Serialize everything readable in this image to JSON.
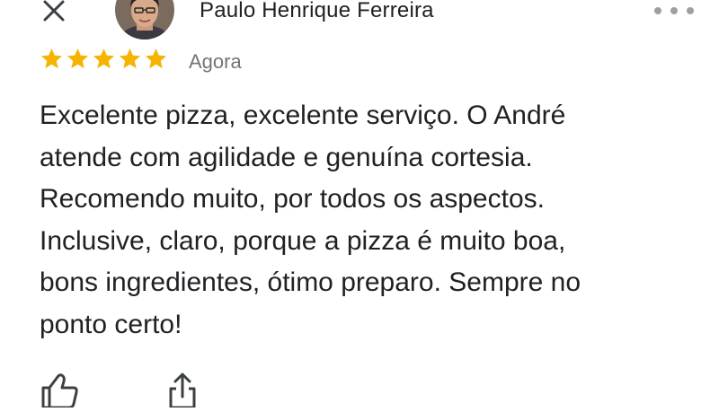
{
  "review": {
    "author_name": "Paulo Henrique Ferreira",
    "rating": 5,
    "rating_max": 5,
    "time": "Agora",
    "text": "Excelente pizza, excelente serviço. O André\natende com agilidade e genuína cortesia.\nRecomendo muito, por todos os aspectos.\nInclusive, claro, porque a pizza é muito boa,\nbons ingredientes, ótimo preparo. Sempre no\nponto certo!"
  },
  "icons": {
    "close": "close-icon",
    "more": "more-horizontal-icon",
    "star": "star-icon",
    "like": "thumbs-up-icon",
    "share": "share-icon"
  },
  "colors": {
    "star": "#F4B400",
    "text": "#202124",
    "secondary_text": "#70757A",
    "icon": "#3C4043"
  }
}
